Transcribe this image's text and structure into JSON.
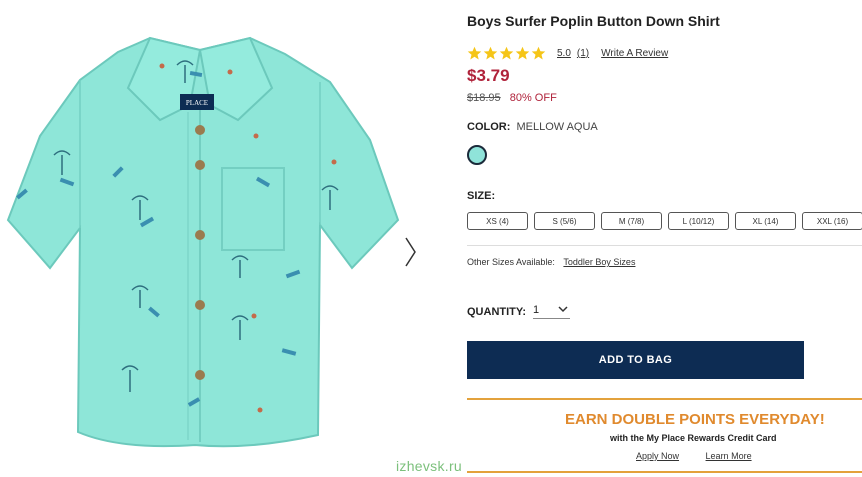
{
  "product": {
    "title": "Boys Surfer Poplin Button Down Shirt",
    "rating": "5.0",
    "review_count": "(1)",
    "write_review": "Write A Review",
    "price": "$3.79",
    "original_price": "$18.95",
    "discount": "80% OFF",
    "brand_tag": "PLACE"
  },
  "color": {
    "label": "COLOR:",
    "value": "MELLOW AQUA",
    "swatch_hex": "#8fe3d9"
  },
  "size": {
    "label": "SIZE:",
    "options": [
      "XS (4)",
      "S (5/6)",
      "M (7/8)",
      "L (10/12)",
      "XL (14)",
      "XXL (16)"
    ],
    "other_label": "Other Sizes Available:",
    "other_link": "Toddler Boy Sizes"
  },
  "quantity": {
    "label": "QUANTITY:",
    "value": "1"
  },
  "add_to_bag": "ADD TO BAG",
  "promo": {
    "headline": "EARN DOUBLE POINTS EVERYDAY!",
    "subline": "with the My Place Rewards Credit Card",
    "apply": "Apply Now",
    "learn": "Learn More",
    "accent": "#e08a2e"
  },
  "watermark": "izhevsk.ru",
  "colors": {
    "price_red": "#b0233b",
    "button_navy": "#0d2c53",
    "star_gold": "#f5c518"
  }
}
